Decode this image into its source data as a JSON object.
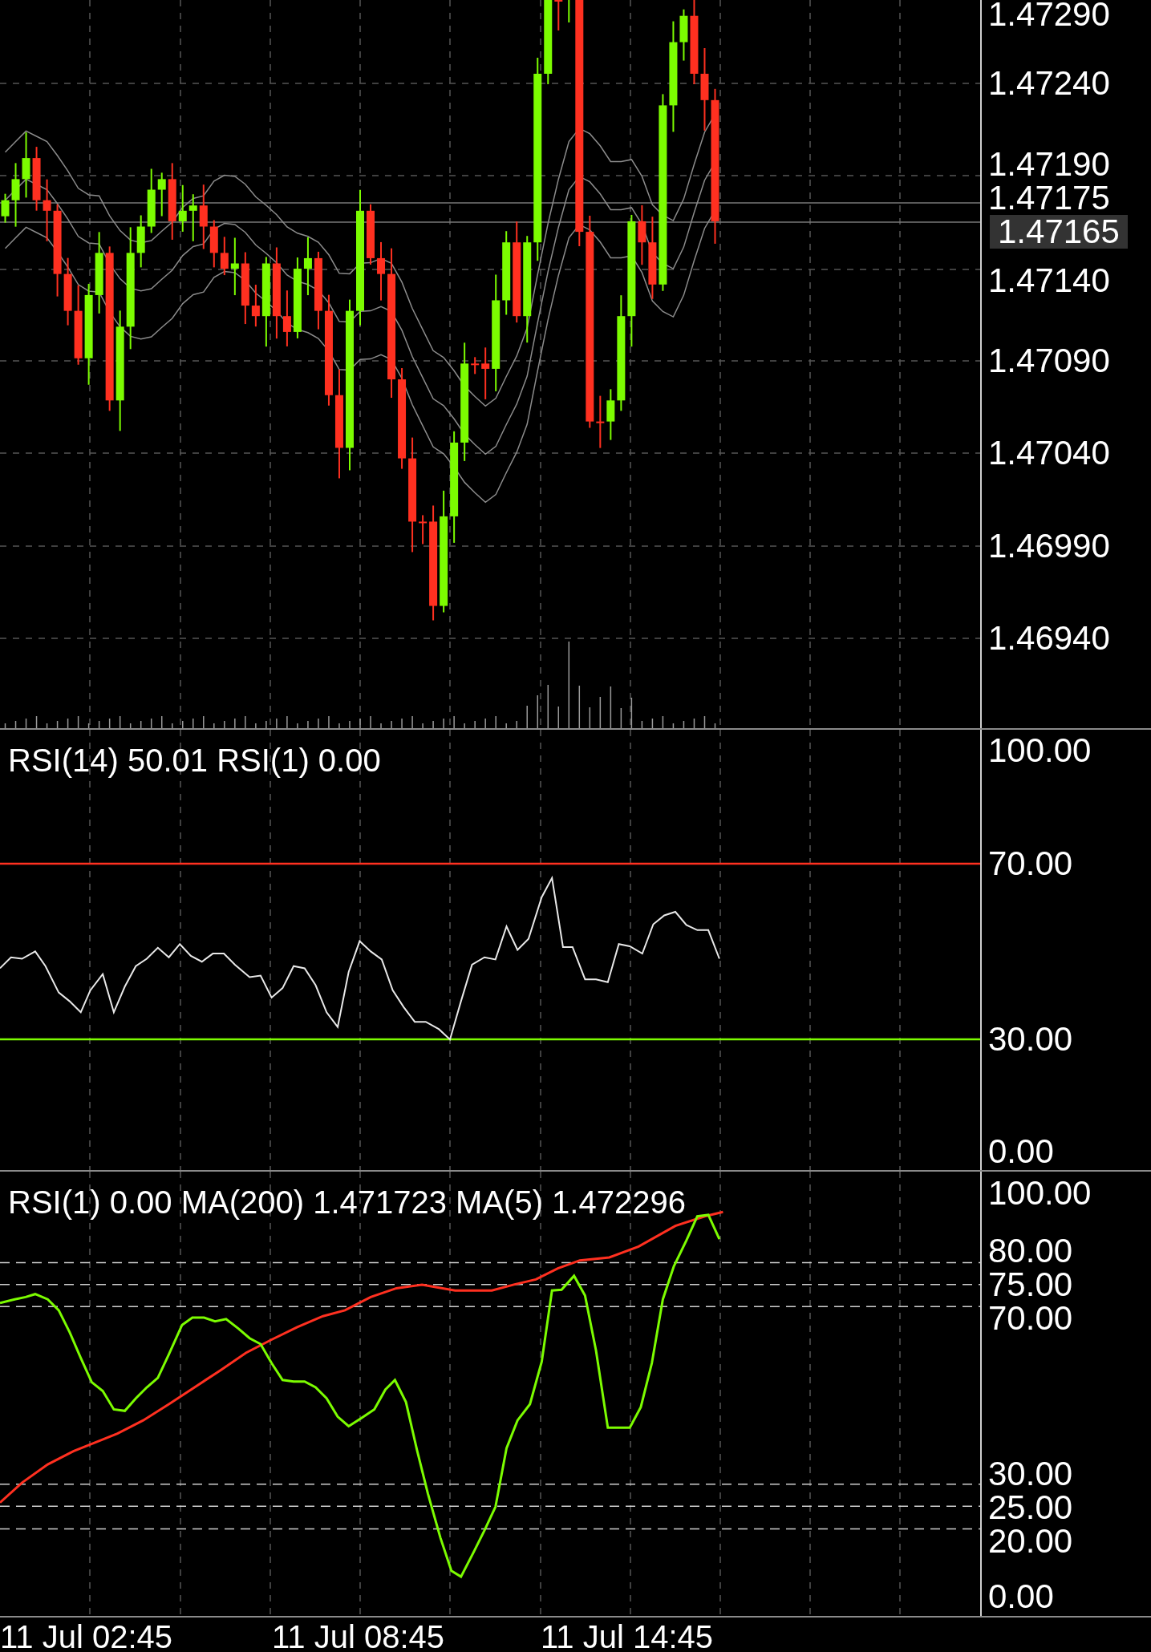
{
  "price_chart": {
    "axis_labels": [
      "1.47290",
      "1.47240",
      "1.47190",
      "1.47140",
      "1.47090",
      "1.47040",
      "1.46990",
      "1.46940"
    ],
    "bid_label": "1.47175",
    "ask_label": "1.47165"
  },
  "rsi_panel": {
    "legend": "RSI(14) 50.01 RSI(1) 0.00",
    "axis_labels": [
      "100.00",
      "70.00",
      "30.00",
      "0.00"
    ]
  },
  "ma_panel": {
    "legend": "RSI(1) 0.00 MA(200) 1.471723 MA(5) 1.472296",
    "axis_labels": [
      "100.00",
      "80.00",
      "75.00",
      "70.00",
      "30.00",
      "25.00",
      "20.00",
      "0.00"
    ]
  },
  "time_axis": {
    "labels": [
      "11 Jul 02:45",
      "11 Jul 08:45",
      "11 Jul 14:45"
    ]
  }
}
